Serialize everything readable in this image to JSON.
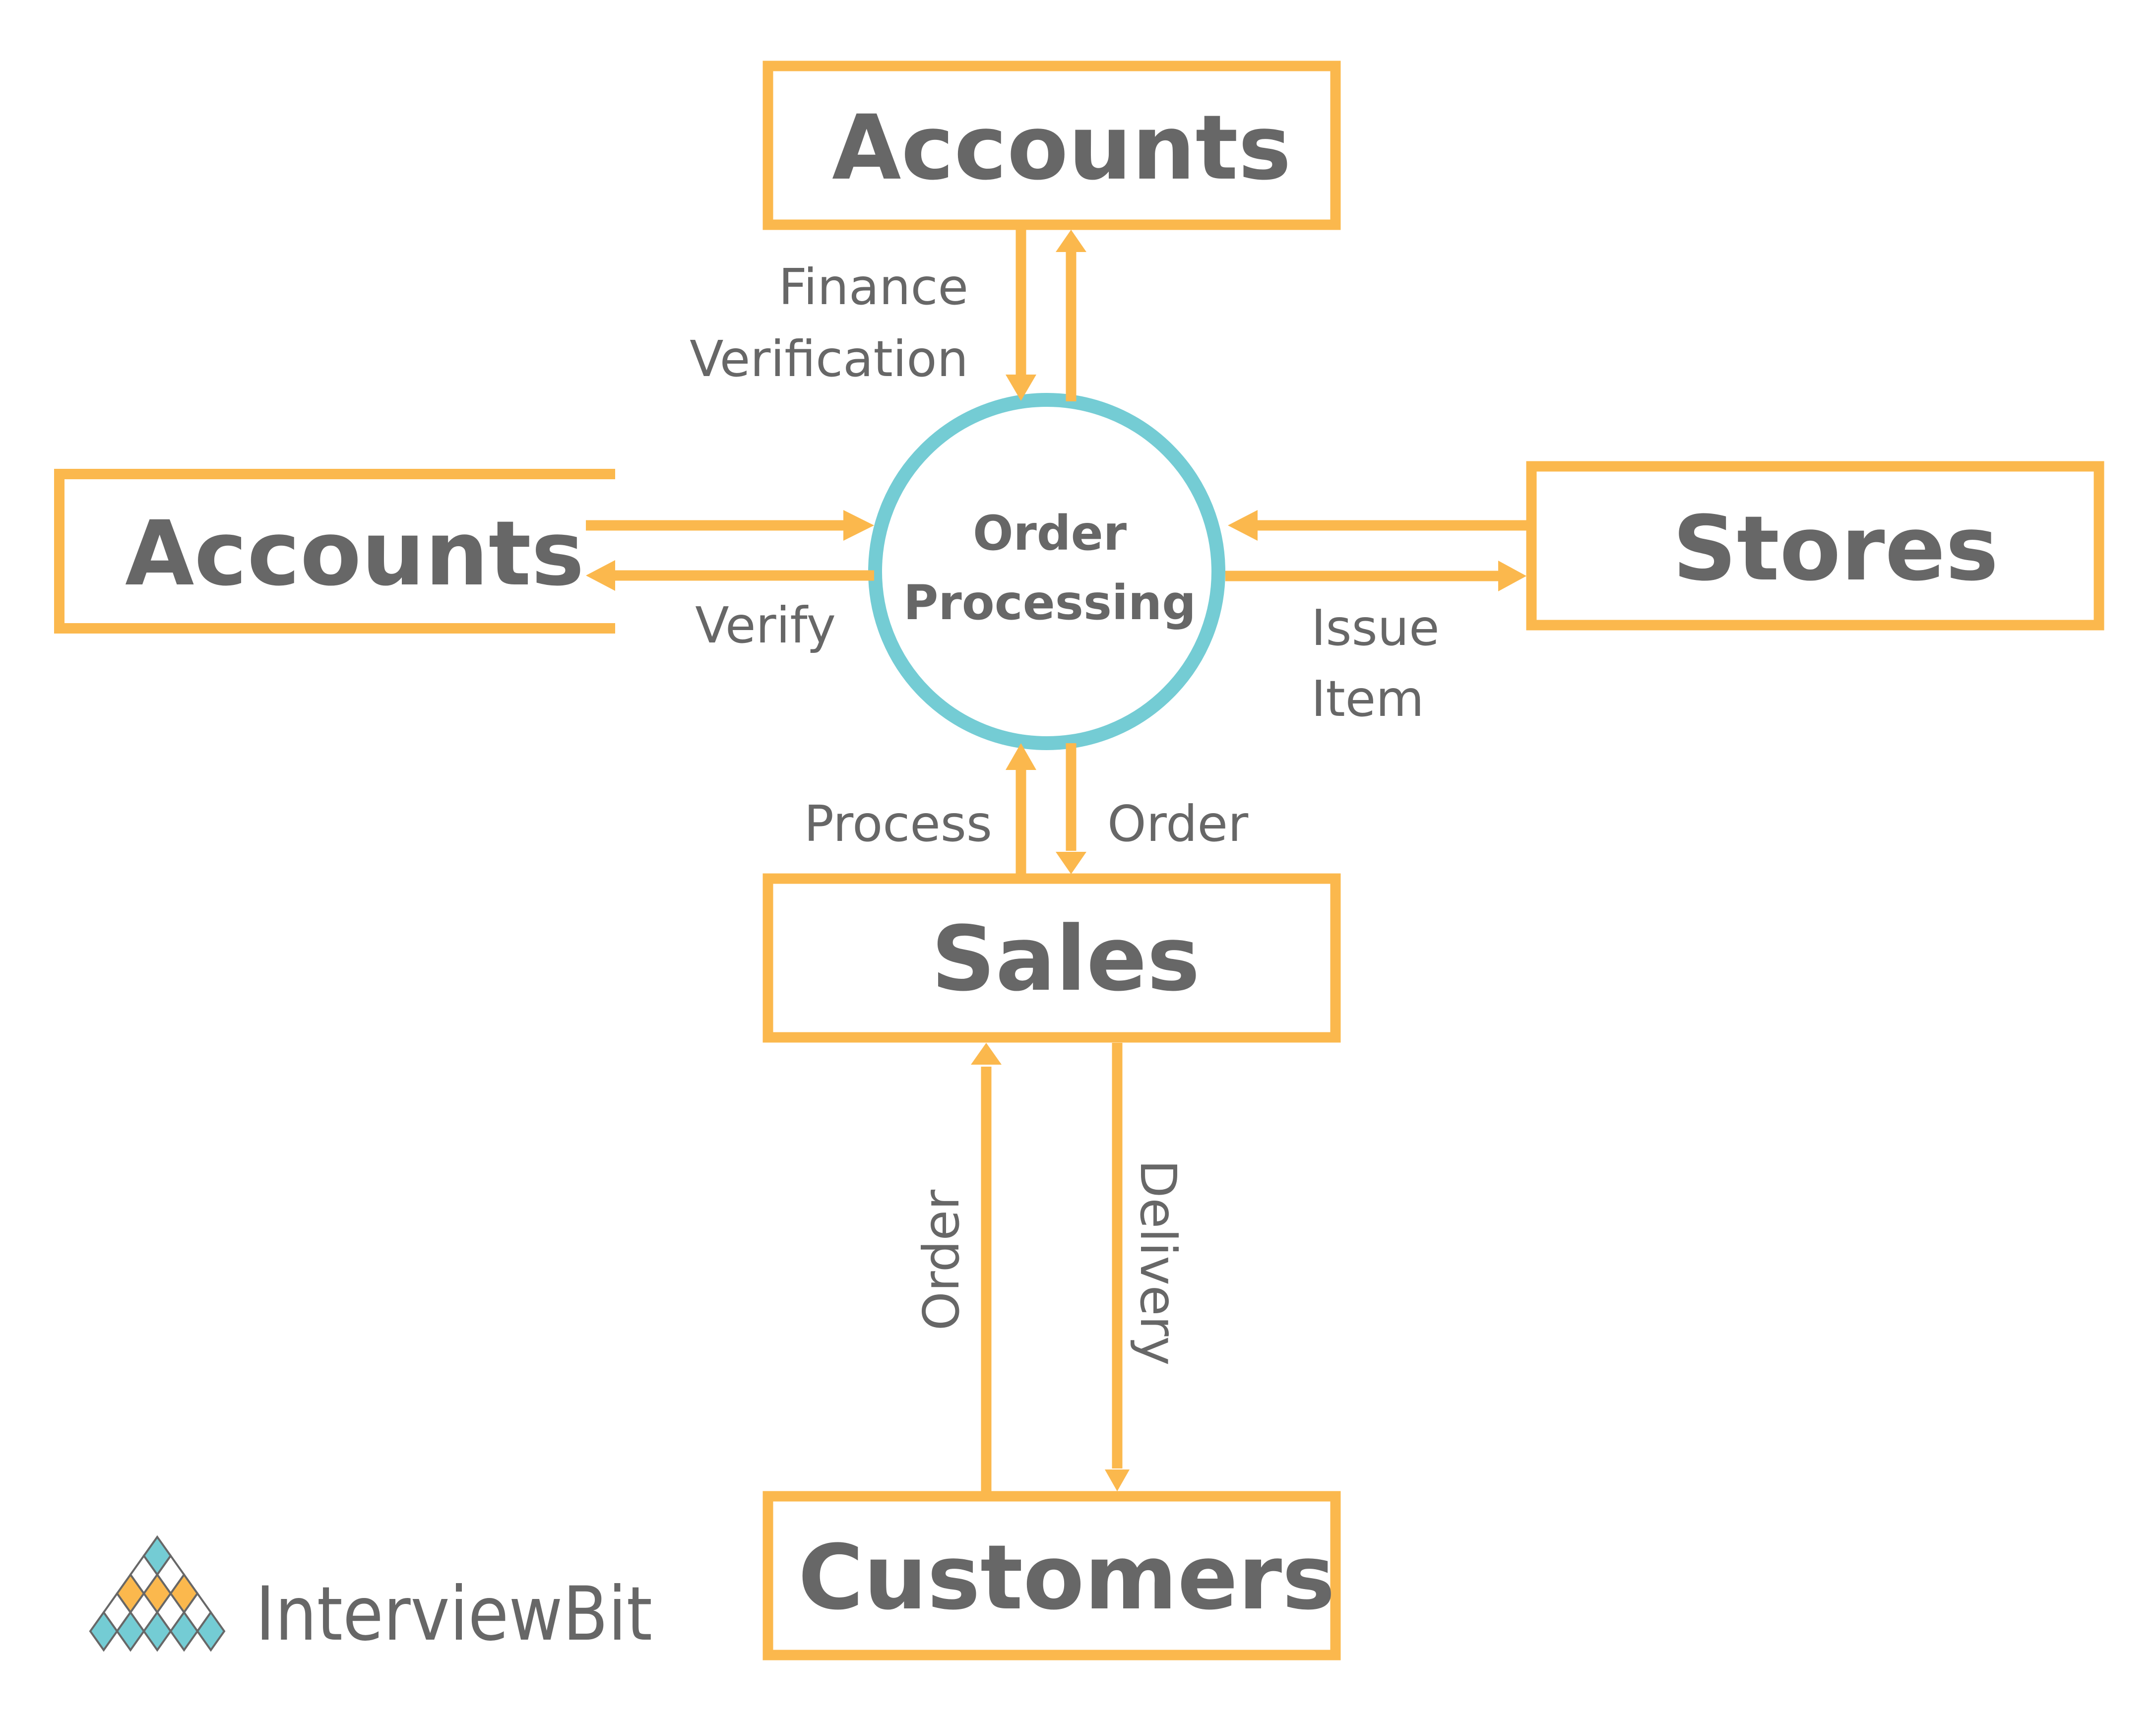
{
  "diagram": {
    "type": "data-flow-diagram",
    "colors": {
      "entity_border": "#FBB84D",
      "arrow": "#FBB84D",
      "process_border": "#74CCD4",
      "text": "#676767",
      "logo_teal": "#74CCD4",
      "logo_orange": "#FBB84D"
    },
    "process": {
      "line1": "Order",
      "line2": "Processing"
    },
    "entities": {
      "accounts_top": "Accounts",
      "accounts_store": "Accounts",
      "stores": "Stores",
      "sales": "Sales",
      "customers": "Customers"
    },
    "flows": {
      "finance_line1": "Finance",
      "finance_line2": "Verification",
      "verify": "Verify",
      "issue_line1": "Issue",
      "issue_line2": "Item",
      "process": "Process",
      "order_to_process": "Order",
      "order_from_customer": "Order",
      "delivery": "Delivery"
    },
    "connections": [
      {
        "from": "Accounts",
        "to": "Order Processing",
        "label": "Finance Verification"
      },
      {
        "from": "Order Processing",
        "to": "Accounts",
        "label": "Finance Verification"
      },
      {
        "from": "Accounts (store)",
        "to": "Order Processing",
        "label": "Verify"
      },
      {
        "from": "Order Processing",
        "to": "Accounts (store)",
        "label": "Verify"
      },
      {
        "from": "Stores",
        "to": "Order Processing",
        "label": "Issue Item"
      },
      {
        "from": "Order Processing",
        "to": "Stores",
        "label": "Issue Item"
      },
      {
        "from": "Sales",
        "to": "Order Processing",
        "label": "Process"
      },
      {
        "from": "Order Processing",
        "to": "Sales",
        "label": "Order"
      },
      {
        "from": "Customers",
        "to": "Sales",
        "label": "Order"
      },
      {
        "from": "Sales",
        "to": "Customers",
        "label": "Delivery"
      }
    ]
  },
  "logo": {
    "text": "InterviewBit",
    "icon": "diamond-triangle-logo-icon"
  }
}
